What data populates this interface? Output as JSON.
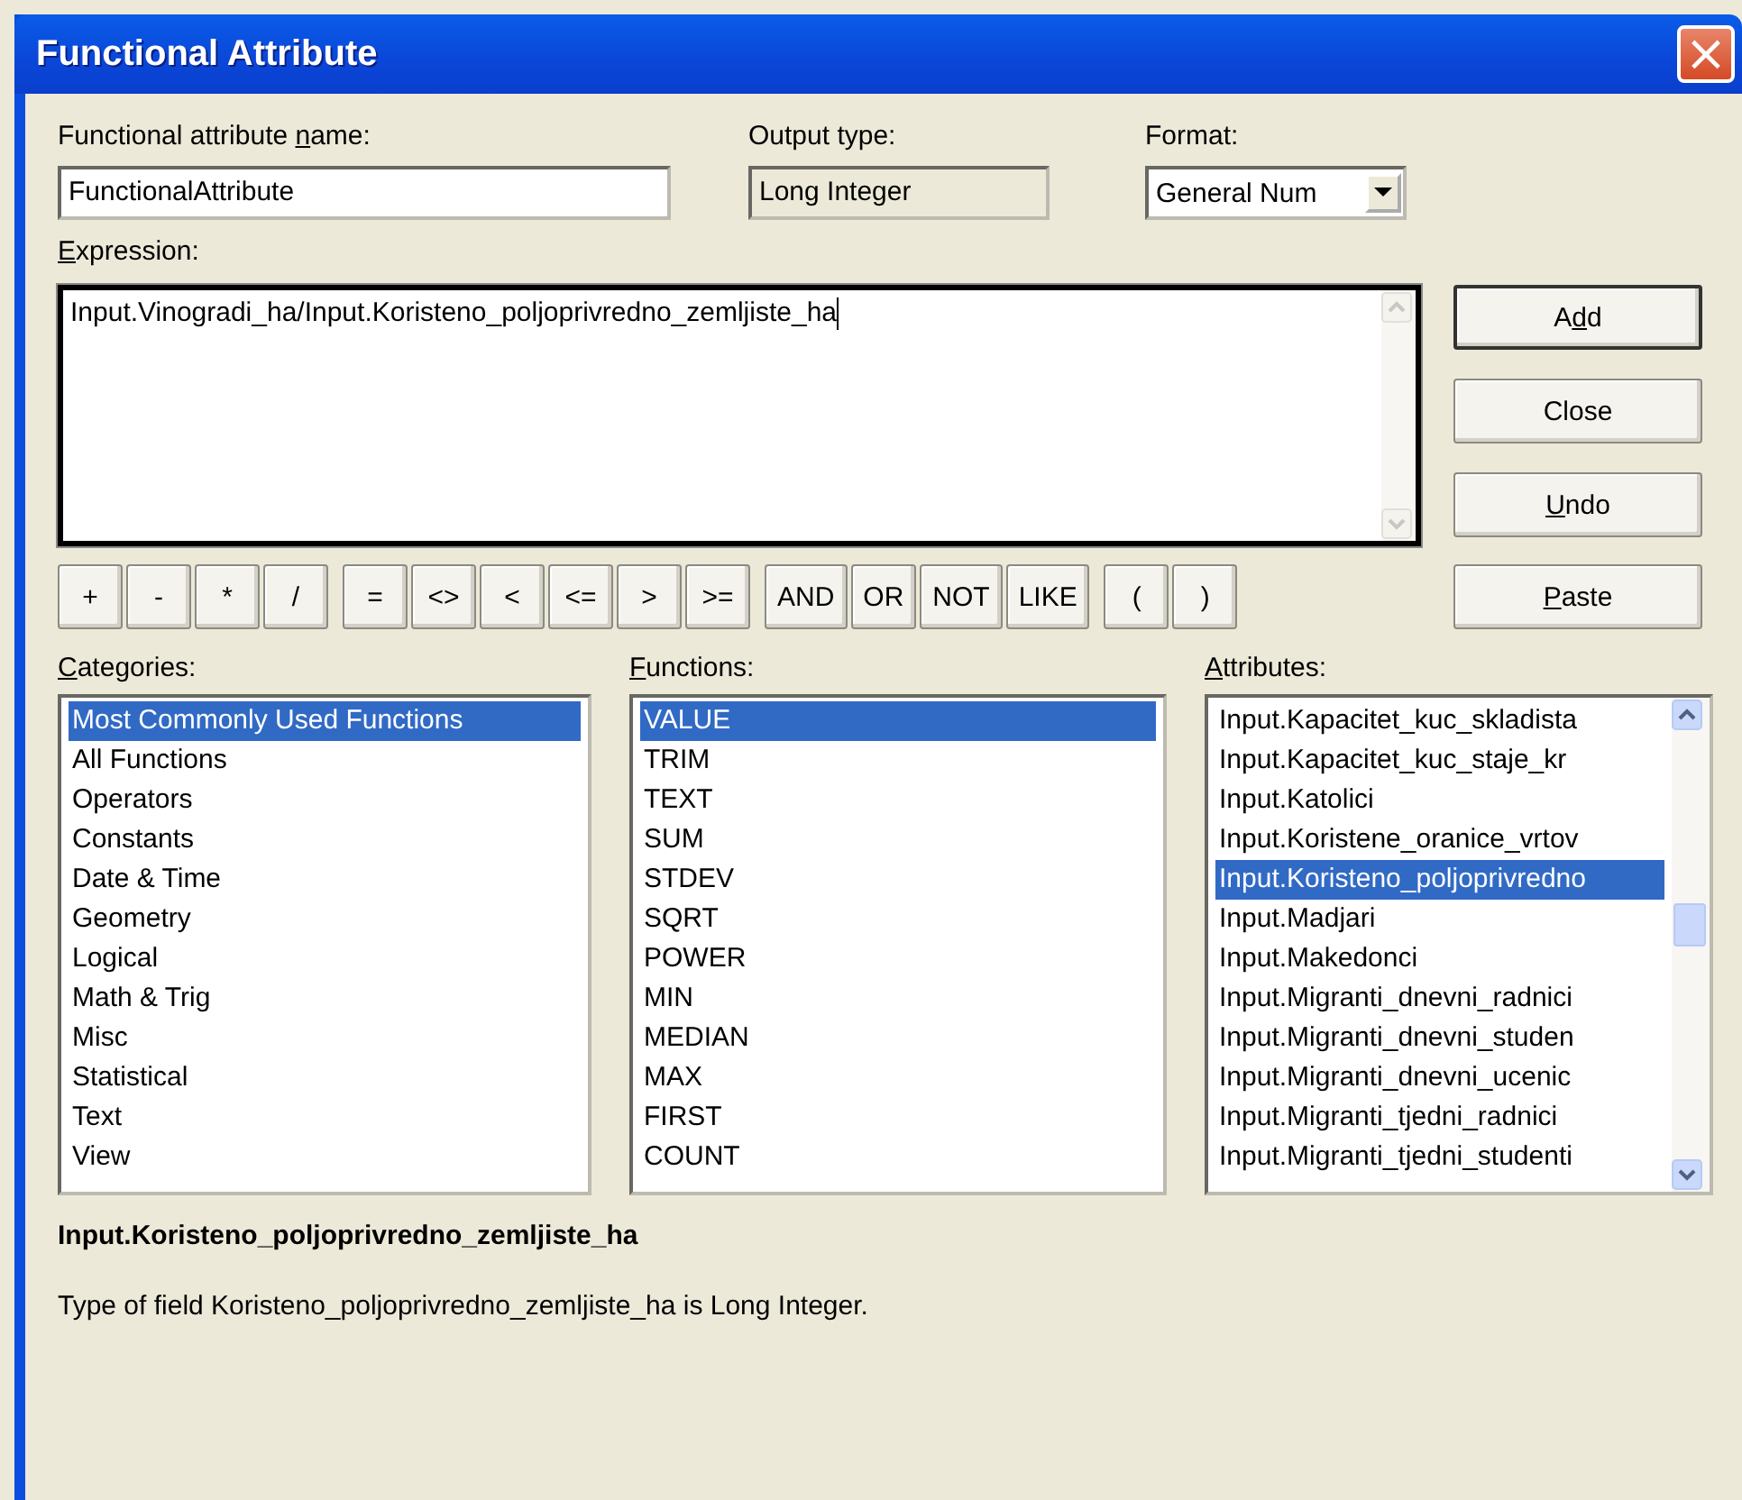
{
  "window": {
    "title": "Functional Attribute",
    "close": "×"
  },
  "name_field": {
    "label": {
      "pre": "Functional attribute ",
      "key": "n",
      "post": "ame:"
    },
    "value": "FunctionalAttribute"
  },
  "output_type": {
    "label": {
      "pre": "Output type:"
    },
    "value": "Long Integer"
  },
  "format": {
    "label": {
      "pre": "Format:"
    },
    "value": "General Num"
  },
  "expression": {
    "label": {
      "key": "E",
      "post": "xpression:"
    },
    "value": "Input.Vinogradi_ha/Input.Koristeno_poljoprivredno_zemljiste_ha"
  },
  "side_buttons": [
    {
      "pre": "A",
      "key": "d",
      "post": "d"
    },
    {
      "pre": "Close"
    },
    {
      "key": "U",
      "post": "ndo"
    }
  ],
  "operator_groups": [
    [
      "+",
      "-",
      "*",
      "/"
    ],
    [
      "=",
      "<>",
      "<",
      "<=",
      ">",
      ">="
    ],
    [
      "AND",
      "OR",
      "NOT",
      "LIKE"
    ],
    [
      "(",
      ")"
    ]
  ],
  "paste_button": {
    "key": "P",
    "post": "aste"
  },
  "lists": [
    {
      "label": {
        "key": "C",
        "post": "ategories:"
      },
      "kind": "plain",
      "items": [
        {
          "text": "Most Commonly Used Functions",
          "selected": true
        },
        {
          "text": "All Functions",
          "selected": false
        },
        {
          "text": "Operators",
          "selected": false
        },
        {
          "text": "Constants",
          "selected": false
        },
        {
          "text": "Date & Time",
          "selected": false
        },
        {
          "text": "Geometry",
          "selected": false
        },
        {
          "text": "Logical",
          "selected": false
        },
        {
          "text": "Math & Trig",
          "selected": false
        },
        {
          "text": "Misc",
          "selected": false
        },
        {
          "text": "Statistical",
          "selected": false
        },
        {
          "text": "Text",
          "selected": false
        },
        {
          "text": "View",
          "selected": false
        }
      ]
    },
    {
      "label": {
        "key": "F",
        "post": "unctions:"
      },
      "kind": "plain",
      "items": [
        {
          "text": "VALUE",
          "selected": true
        },
        {
          "text": "TRIM",
          "selected": false
        },
        {
          "text": "TEXT",
          "selected": false
        },
        {
          "text": "SUM",
          "selected": false
        },
        {
          "text": "STDEV",
          "selected": false
        },
        {
          "text": "SQRT",
          "selected": false
        },
        {
          "text": "POWER",
          "selected": false
        },
        {
          "text": "MIN",
          "selected": false
        },
        {
          "text": "MEDIAN",
          "selected": false
        },
        {
          "text": "MAX",
          "selected": false
        },
        {
          "text": "FIRST",
          "selected": false
        },
        {
          "text": "COUNT",
          "selected": false
        }
      ]
    },
    {
      "label": {
        "key": "A",
        "post": "ttributes:"
      },
      "kind": "scrolling",
      "items": [
        {
          "text": "Input.Kapacitet_kuc_skladista",
          "selected": false
        },
        {
          "text": "Input.Kapacitet_kuc_staje_kr",
          "selected": false
        },
        {
          "text": "Input.Katolici",
          "selected": false
        },
        {
          "text": "Input.Koristene_oranice_vrtov",
          "selected": false
        },
        {
          "text": "Input.Koristeno_poljoprivredno",
          "selected": true
        },
        {
          "text": "Input.Madjari",
          "selected": false
        },
        {
          "text": "Input.Makedonci",
          "selected": false
        },
        {
          "text": "Input.Migranti_dnevni_radnici",
          "selected": false
        },
        {
          "text": "Input.Migranti_dnevni_studen",
          "selected": false
        },
        {
          "text": "Input.Migranti_dnevni_ucenic",
          "selected": false
        },
        {
          "text": "Input.Migranti_tjedni_radnici",
          "selected": false
        },
        {
          "text": "Input.Migranti_tjedni_studenti",
          "selected": false
        }
      ]
    }
  ],
  "info": {
    "heading": "Input.Koristeno_poljoprivredno_zemljiste_ha",
    "description": "Type of field Koristeno_poljoprivredno_zemljiste_ha is Long Integer."
  }
}
